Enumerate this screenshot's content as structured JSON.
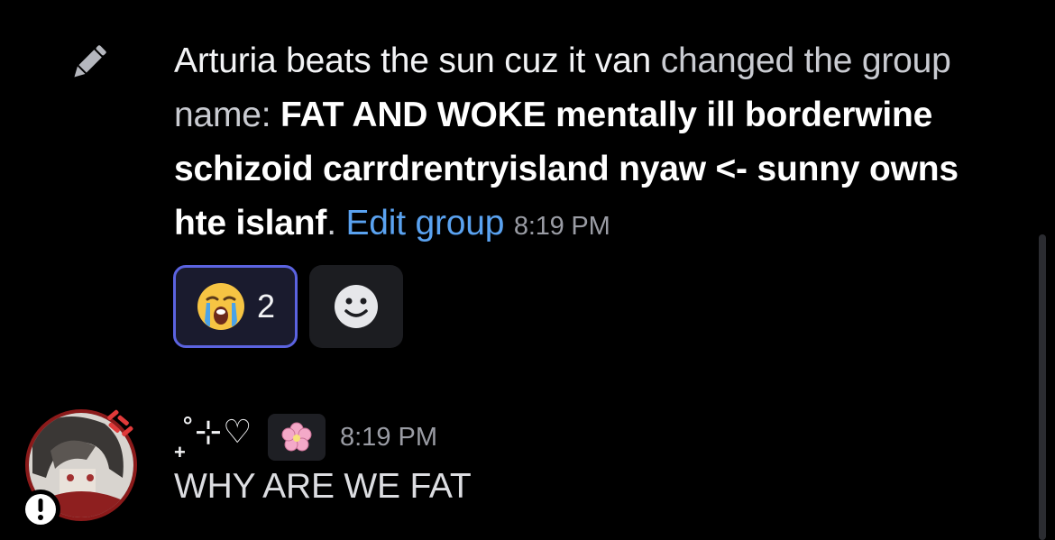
{
  "system_message": {
    "icon": "pencil-icon",
    "author": "Arturia beats the sun cuz it van",
    "action": " changed the group name: ",
    "group_name": "FAT AND WOKE mentally ill borderwine schizoid carrdrentryisland nyaw <- sunny owns hte islanf",
    "period": ". ",
    "edit_link": "Edit group",
    "timestamp": "8:19 PM",
    "reactions": [
      {
        "emoji": "loudly-crying-face-emoji",
        "count": "2",
        "active": true
      }
    ],
    "add_reaction_icon": "smiley-add-reaction-icon"
  },
  "message": {
    "username": "˚⊹♡",
    "username_prefix": "+",
    "tag_icon": "cherry-blossom-icon",
    "timestamp": "8:19 PM",
    "content": "WHY ARE WE FAT"
  },
  "colors": {
    "background": "#000000",
    "link": "#5aa2f0",
    "reaction_border": "#5b63e0",
    "reaction_bg": "#1a1b2e",
    "timestamp": "#9a9ca4"
  }
}
